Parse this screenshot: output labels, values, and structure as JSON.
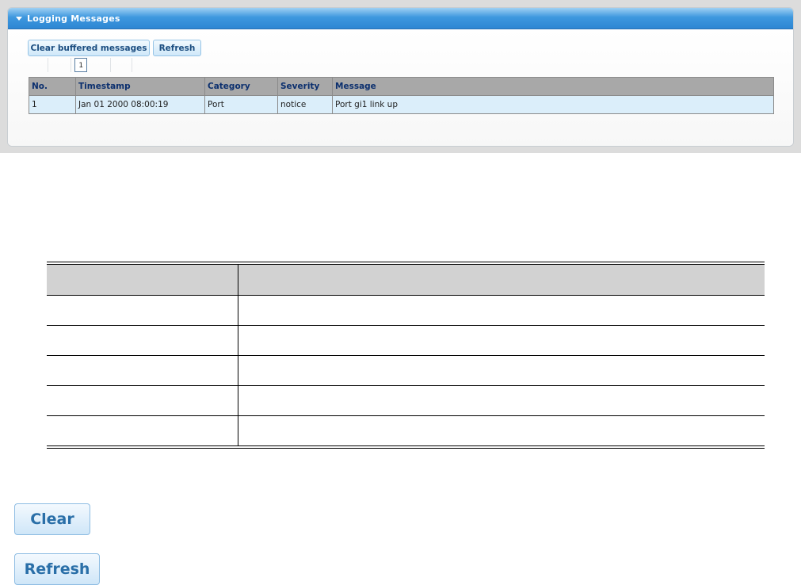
{
  "panel": {
    "title": "Logging Messages"
  },
  "toolbar": {
    "clear_label": "Clear buffered messages",
    "refresh_label": "Refresh"
  },
  "pager": {
    "current_page": "1"
  },
  "log_table": {
    "headers": [
      "No.",
      "Timestamp",
      "Category",
      "Severity",
      "Message"
    ],
    "rows": [
      [
        "1",
        "Jan 01 2000 08:00:19",
        "Port",
        "notice",
        "Port gi1 link up"
      ]
    ]
  },
  "buttons": {
    "clear": "Clear",
    "refresh": "Refresh"
  }
}
